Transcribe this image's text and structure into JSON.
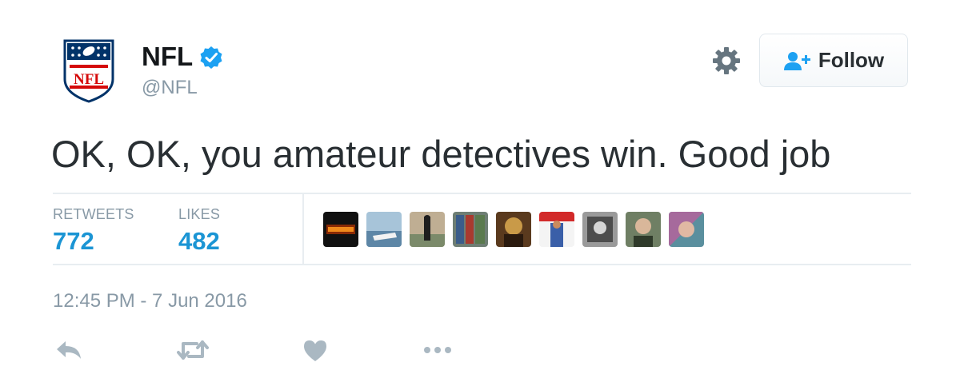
{
  "account": {
    "display_name": "NFL",
    "handle": "@NFL",
    "verified": true
  },
  "header": {
    "follow_label": "Follow"
  },
  "tweet": {
    "text": "OK, OK, you amateur detectives win. Good job",
    "timestamp": "12:45 PM - 7 Jun 2016"
  },
  "stats": {
    "retweets_label": "RETWEETS",
    "retweets_value": "772",
    "likes_label": "LIKES",
    "likes_value": "482"
  },
  "colors": {
    "accent": "#1b95d4",
    "verified": "#1da1f2",
    "muted": "#8899a6",
    "text": "#292f33"
  },
  "icons": [
    "nfl-logo",
    "verified-badge-icon",
    "gear-icon",
    "add-user-icon",
    "reply-icon",
    "retweet-icon",
    "heart-icon",
    "more-icon"
  ]
}
